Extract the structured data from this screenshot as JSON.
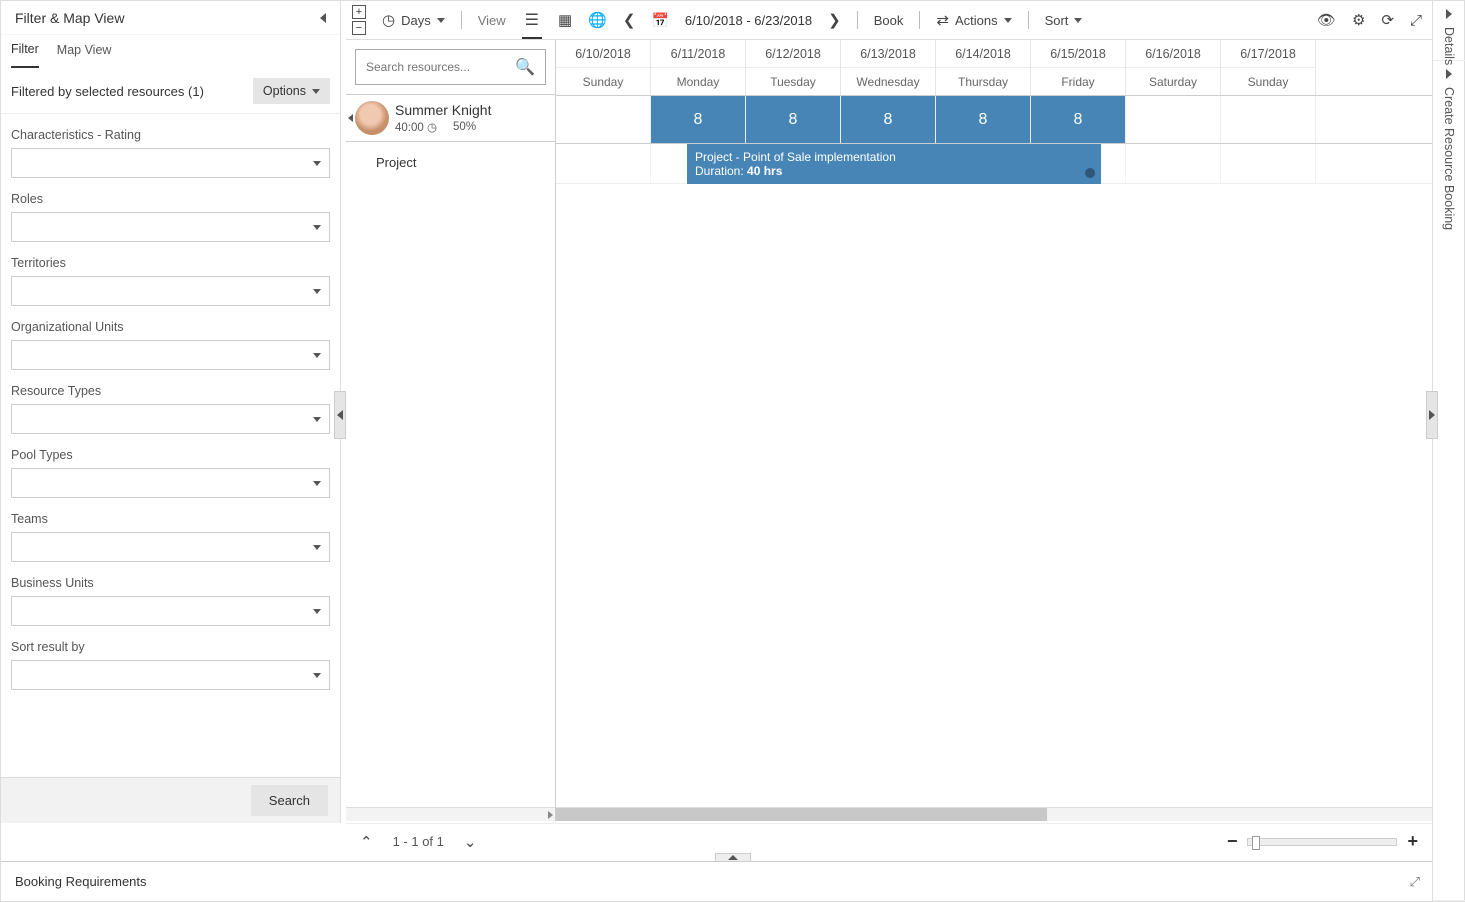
{
  "sidebar": {
    "title": "Filter & Map View",
    "tabs": {
      "filter": "Filter",
      "map": "Map View"
    },
    "filtered_label": "Filtered by selected resources (1)",
    "options_label": "Options",
    "fields": {
      "characteristics": "Characteristics - Rating",
      "roles": "Roles",
      "territories": "Territories",
      "org_units": "Organizational Units",
      "resource_types": "Resource Types",
      "pool_types": "Pool Types",
      "teams": "Teams",
      "business_units": "Business Units",
      "sort_by": "Sort result by"
    },
    "search_label": "Search"
  },
  "toolbar": {
    "days_label": "Days",
    "view_label": "View",
    "date_range": "6/10/2018 - 6/23/2018",
    "book_label": "Book",
    "actions_label": "Actions",
    "sort_label": "Sort"
  },
  "resources": {
    "search_placeholder": "Search resources...",
    "row": {
      "name": "Summer Knight",
      "time": "40:00",
      "util": "50%",
      "subtask": "Project"
    }
  },
  "calendar": {
    "columns": [
      {
        "date": "6/10/2018",
        "day": "Sunday",
        "work": false
      },
      {
        "date": "6/11/2018",
        "day": "Monday",
        "work": true,
        "hours": "8"
      },
      {
        "date": "6/12/2018",
        "day": "Tuesday",
        "work": true,
        "hours": "8"
      },
      {
        "date": "6/13/2018",
        "day": "Wednesday",
        "work": true,
        "hours": "8"
      },
      {
        "date": "6/14/2018",
        "day": "Thursday",
        "work": true,
        "hours": "8"
      },
      {
        "date": "6/15/2018",
        "day": "Friday",
        "work": true,
        "hours": "8"
      },
      {
        "date": "6/16/2018",
        "day": "Saturday",
        "work": false
      },
      {
        "date": "6/17/2018",
        "day": "Sunday",
        "work": false
      }
    ],
    "booking": {
      "title": "Project - Point of Sale implementation",
      "duration_label": "Duration: ",
      "duration_value": "40 hrs"
    }
  },
  "pager": {
    "text": "1 - 1 of 1"
  },
  "bottom_panel": {
    "title": "Booking Requirements"
  },
  "right_rail": {
    "details": "Details",
    "create": "Create Resource Booking"
  }
}
